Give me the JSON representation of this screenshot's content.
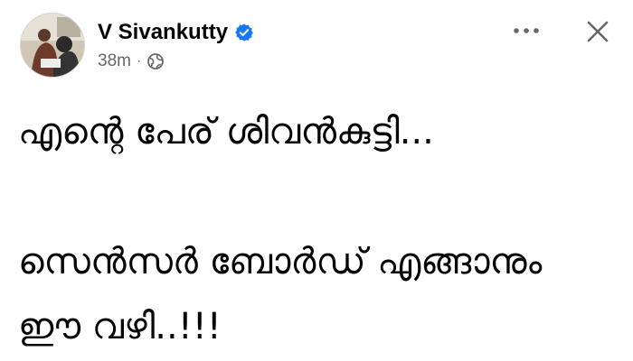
{
  "post": {
    "author": {
      "name": "V Sivankutty",
      "verified": true,
      "avatar_icon": "profile-photo"
    },
    "meta": {
      "time": "38m",
      "separator": "·",
      "audience_icon": "globe-icon"
    },
    "actions": {
      "more_icon": "more-horizontal-icon",
      "close_icon": "close-icon"
    },
    "text_lines": [
      "എന്റെ പേര് ശിവൻകുട്ടി...",
      "",
      "സെൻസർ ബോർഡ് എങ്ങാനും",
      "ഈ വഴി..!!!"
    ]
  },
  "colors": {
    "text_primary": "#050505",
    "text_secondary": "#65676b",
    "verified_blue": "#1877f2",
    "background": "#ffffff"
  }
}
